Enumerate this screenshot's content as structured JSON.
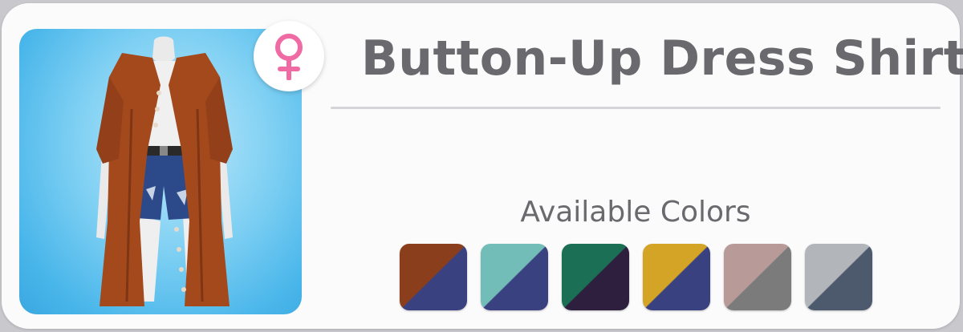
{
  "item": {
    "title": "Button-Up Dress Shirt",
    "gender_icon": "female-symbol-icon",
    "gender_icon_color": "#f06aa4",
    "thumbnail_subject": "long rust button-up shirt over denim shorts on mannequin"
  },
  "colors_section": {
    "label": "Available Colors",
    "swatches": [
      {
        "primary": "#8b3e1c",
        "secondary": "#3a4180"
      },
      {
        "primary": "#73bdb8",
        "secondary": "#3a4180"
      },
      {
        "primary": "#1a6f55",
        "secondary": "#2e1f3f"
      },
      {
        "primary": "#d4a426",
        "secondary": "#3a4180"
      },
      {
        "primary": "#b89a98",
        "secondary": "#7b7b7b"
      },
      {
        "primary": "#b2b6ba",
        "secondary": "#4d5a6e"
      }
    ]
  }
}
